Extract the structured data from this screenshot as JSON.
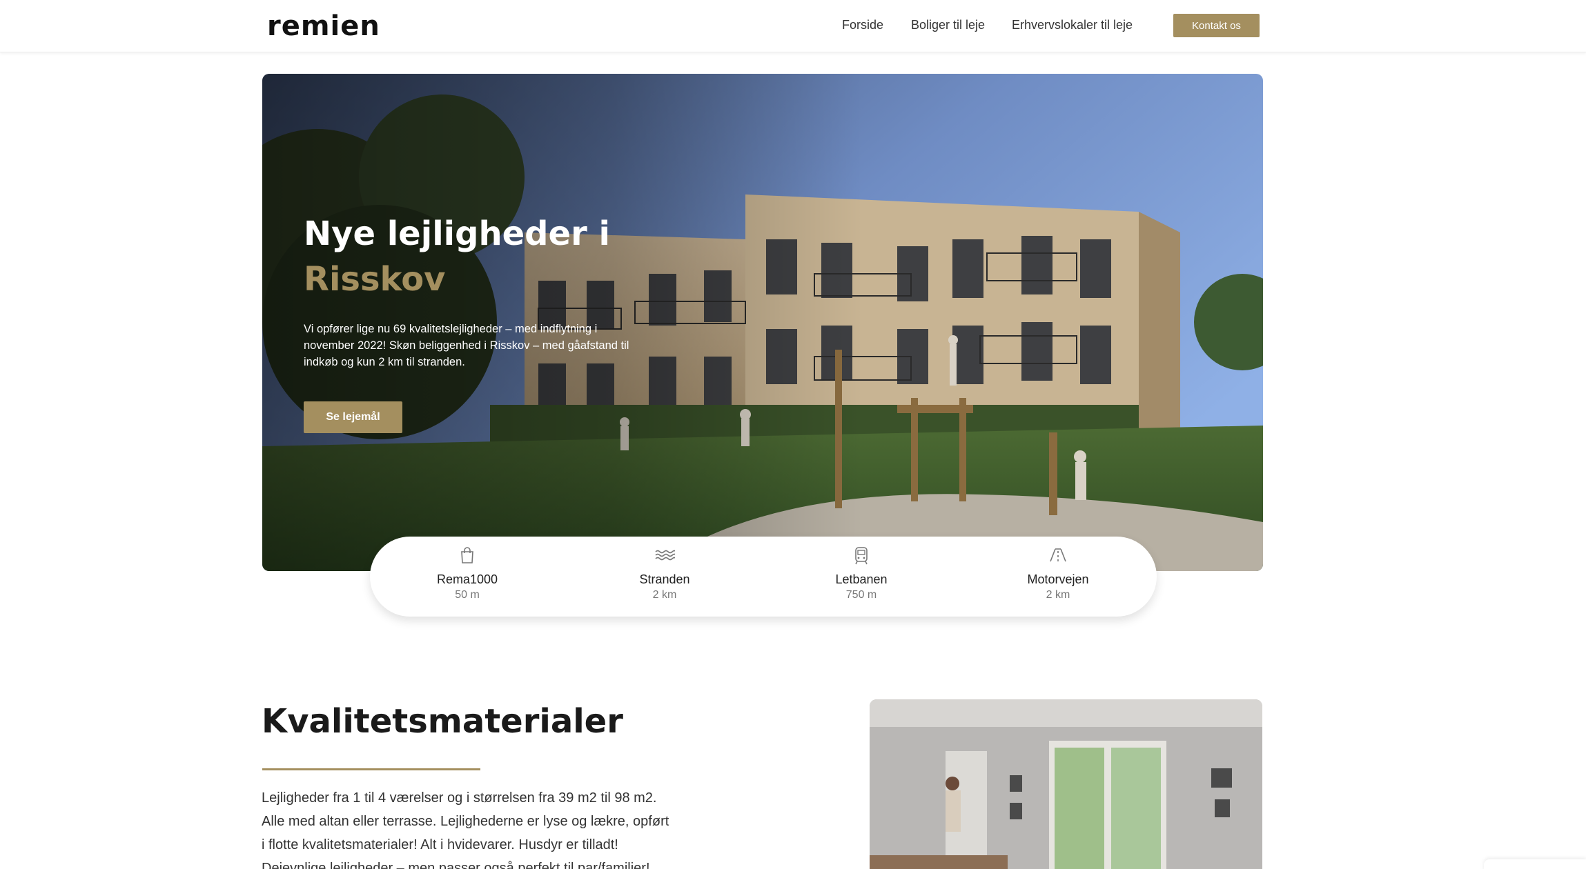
{
  "header": {
    "logo": "remien",
    "nav": [
      "Forside",
      "Boliger til leje",
      "Erhvervslokaler til leje"
    ],
    "cta": "Kontakt os"
  },
  "hero": {
    "title_line1": "Nye lejligheder i",
    "title_line2": "Risskov",
    "text": "Vi opfører lige nu 69 kvalitetslejligheder – med indflytning i november 2022! Skøn beliggenhed i Risskov – med gåafstand til indkøb og kun 2 km til stranden.",
    "button": "Se lejemål"
  },
  "distances": [
    {
      "name": "Rema1000",
      "value": "50 m",
      "icon": "shopping-bag-icon"
    },
    {
      "name": "Stranden",
      "value": "2 km",
      "icon": "waves-icon"
    },
    {
      "name": "Letbanen",
      "value": "750 m",
      "icon": "train-icon"
    },
    {
      "name": "Motorvejen",
      "value": "2 km",
      "icon": "road-icon"
    }
  ],
  "section": {
    "title": "Kvalitetsmaterialer",
    "text": "Lejligheder fra 1 til 4 værelser og i størrelsen fra 39 m2 til 98 m2. Alle med altan eller terrasse. Lejlighederne er lyse og lækre, opført i flotte kvalitetsmaterialer! Alt i hvidevarer. Husdyr er tilladt! Dejevnlige lejligheder – men passer også perfekt til par/familier!"
  },
  "colors": {
    "accent": "#a48f5f",
    "text": "#1a1a1a"
  }
}
